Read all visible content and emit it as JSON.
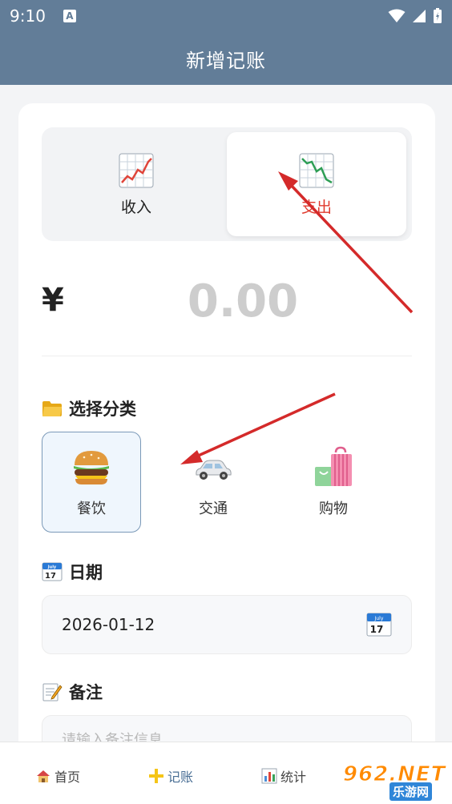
{
  "status_bar": {
    "time": "9:10",
    "a_icon": "A"
  },
  "app_bar": {
    "title": "新增记账"
  },
  "type_toggle": {
    "income": {
      "label": "收入",
      "icon": "chart-increasing-icon"
    },
    "expense": {
      "label": "支出",
      "icon": "chart-decreasing-icon",
      "selected": true
    }
  },
  "amount": {
    "currency": "¥",
    "value": "0.00"
  },
  "category_section": {
    "title": "选择分类",
    "icon": "folder-icon",
    "items": [
      {
        "label": "餐饮",
        "icon": "hamburger-icon",
        "selected": true
      },
      {
        "label": "交通",
        "icon": "car-icon",
        "selected": false
      },
      {
        "label": "购物",
        "icon": "shopping-bags-icon",
        "selected": false
      }
    ]
  },
  "date_section": {
    "title": "日期",
    "icon": "calendar-icon",
    "value": "2026-01-12",
    "calendar_month": "July",
    "calendar_day": "17"
  },
  "note_section": {
    "title": "备注",
    "icon": "memo-icon",
    "placeholder": "请输入备注信息"
  },
  "bottom_nav": {
    "items": [
      {
        "label": "首页",
        "icon": "house-icon"
      },
      {
        "label": "记账",
        "icon": "plus-icon",
        "active": true
      },
      {
        "label": "统计",
        "icon": "bar-chart-icon"
      }
    ]
  },
  "watermark": {
    "line1": "962.NET",
    "line2": "乐游网"
  },
  "colors": {
    "header": "#627d98",
    "expense_red": "#e03a2e",
    "selected_border": "#7b99b8",
    "annotation_arrow": "#d42a2a"
  }
}
